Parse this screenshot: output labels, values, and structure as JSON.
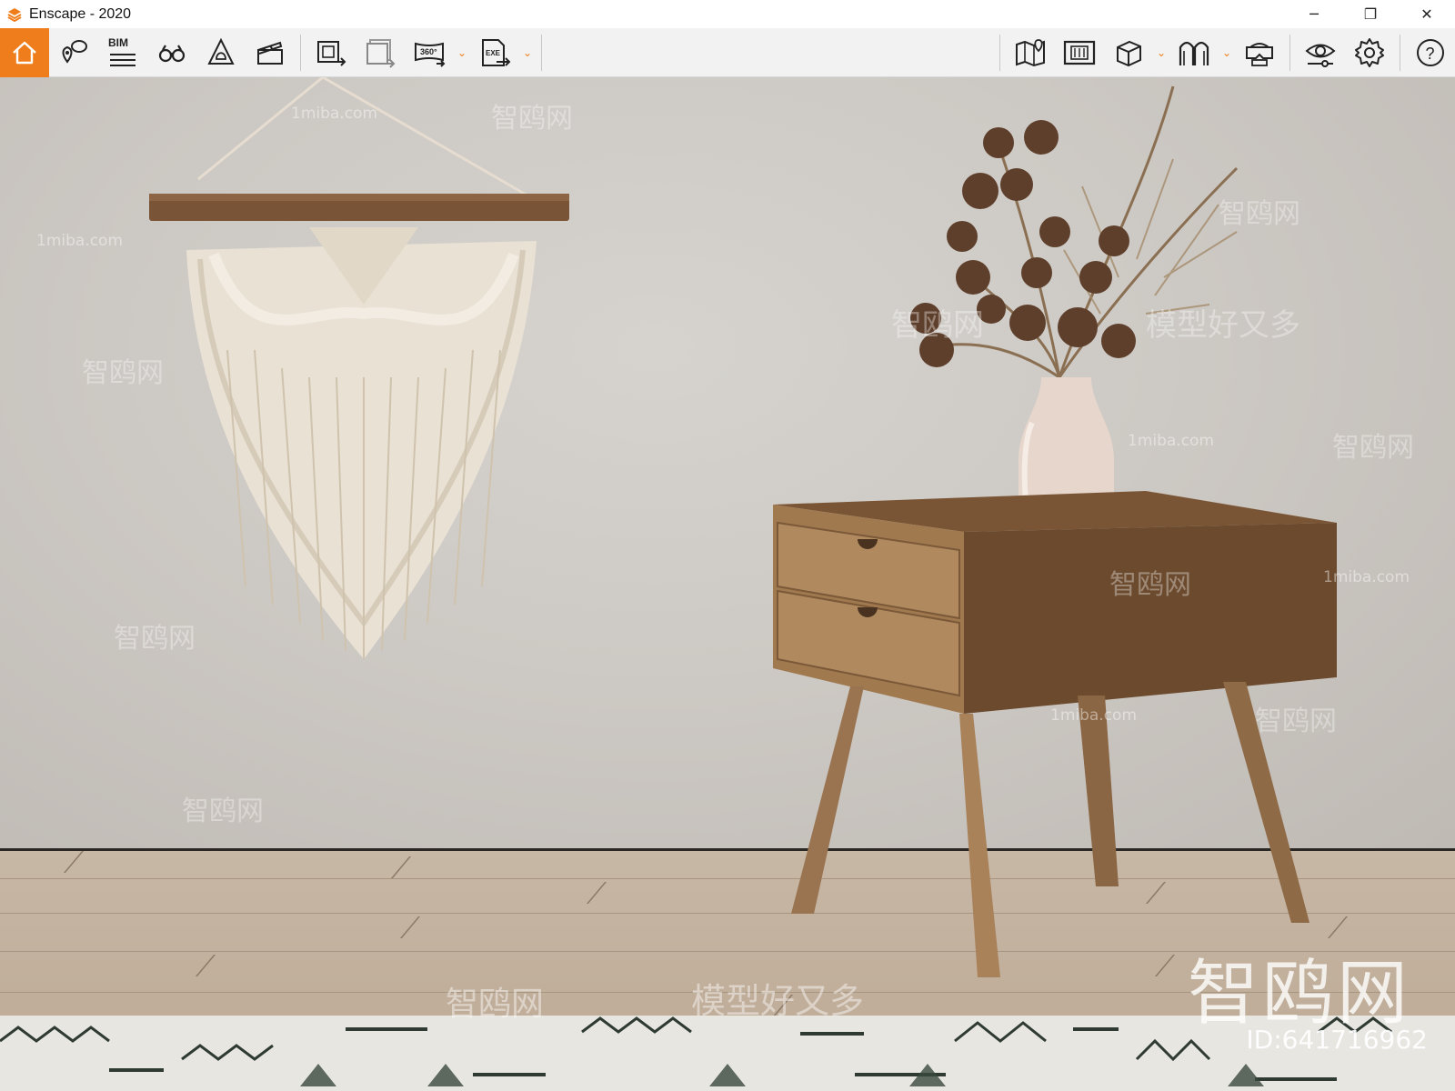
{
  "window": {
    "title": "Enscape - 2020",
    "controls": {
      "minimize": "─",
      "restore": "❐",
      "close": "✕"
    }
  },
  "toolbar": {
    "accent_color": "#f07d1b",
    "left": [
      {
        "name": "home",
        "icon": "home-icon"
      },
      {
        "name": "sync-views",
        "icon": "map-pin-chat-icon"
      },
      {
        "name": "bim",
        "icon": "bim-icon",
        "text": "BIM"
      },
      {
        "name": "views",
        "icon": "binoculars-icon"
      },
      {
        "name": "capture-settings",
        "icon": "triangle-bell-icon"
      },
      {
        "name": "video-editor",
        "icon": "clapperboard-icon"
      },
      {
        "name": "export-image",
        "icon": "export-image-icon"
      },
      {
        "name": "batch-export",
        "icon": "batch-export-icon"
      },
      {
        "name": "panorama",
        "icon": "panorama-360-icon",
        "text": "360°"
      },
      {
        "name": "export-exe",
        "icon": "export-exe-icon",
        "text": "EXE"
      }
    ],
    "right": [
      {
        "name": "map",
        "icon": "map-pin-icon"
      },
      {
        "name": "asset-library",
        "icon": "building-icon"
      },
      {
        "name": "cube",
        "icon": "cube-icon"
      },
      {
        "name": "materials",
        "icon": "arches-icon"
      },
      {
        "name": "vr-headset",
        "icon": "vr-headset-icon"
      },
      {
        "name": "visual-settings",
        "icon": "eye-icon"
      },
      {
        "name": "settings",
        "icon": "gear-icon"
      },
      {
        "name": "help",
        "icon": "help-icon",
        "text": "?"
      }
    ]
  },
  "viewport": {
    "watermarks": {
      "brand": "智鸥网",
      "id": "ID:641716962",
      "small_site": "1miba.com",
      "slogan": "模型好又多"
    }
  }
}
